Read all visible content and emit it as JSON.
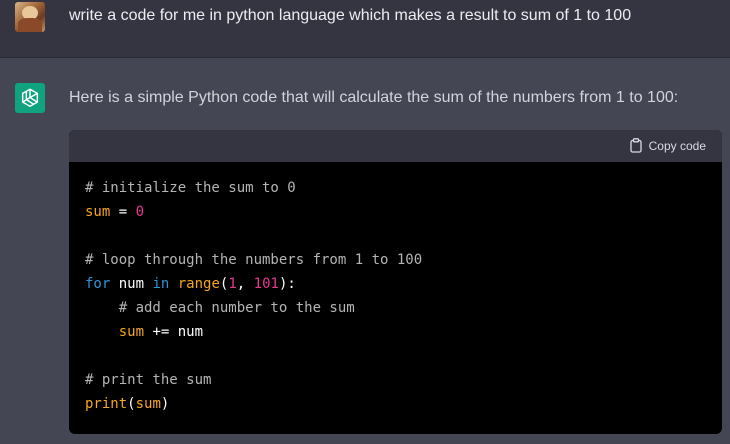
{
  "user_message": {
    "avatar": "user-avatar",
    "text": "write a code for me in python language which makes a result to sum of 1 to 100"
  },
  "assistant_message": {
    "avatar": "openai-logo-icon",
    "text": "Here is a simple Python code that will calculate the sum of the numbers from 1 to 100:",
    "code_block": {
      "copy_label": "Copy code",
      "lines": [
        [
          {
            "t": "# initialize the sum to 0",
            "c": "comment"
          }
        ],
        [
          {
            "t": "sum",
            "c": "var"
          },
          {
            "t": " = ",
            "c": "op"
          },
          {
            "t": "0",
            "c": "num"
          }
        ],
        [],
        [
          {
            "t": "# loop through the numbers from 1 to 100",
            "c": "comment"
          }
        ],
        [
          {
            "t": "for",
            "c": "kw"
          },
          {
            "t": " num ",
            "c": "op"
          },
          {
            "t": "in",
            "c": "kw"
          },
          {
            "t": " ",
            "c": "op"
          },
          {
            "t": "range",
            "c": "fn"
          },
          {
            "t": "(",
            "c": "op"
          },
          {
            "t": "1",
            "c": "num"
          },
          {
            "t": ", ",
            "c": "op"
          },
          {
            "t": "101",
            "c": "num"
          },
          {
            "t": "):",
            "c": "op"
          }
        ],
        [
          {
            "t": "    # add each number to the sum",
            "c": "comment"
          }
        ],
        [
          {
            "t": "    ",
            "c": "op"
          },
          {
            "t": "sum",
            "c": "var"
          },
          {
            "t": " += num",
            "c": "op"
          }
        ],
        [],
        [
          {
            "t": "# print the sum",
            "c": "comment"
          }
        ],
        [
          {
            "t": "print",
            "c": "fn"
          },
          {
            "t": "(",
            "c": "op"
          },
          {
            "t": "sum",
            "c": "var"
          },
          {
            "t": ")",
            "c": "op"
          }
        ]
      ]
    }
  },
  "colors": {
    "user_bg": "#343541",
    "assistant_bg": "#444654",
    "accent_green": "#10a37f",
    "code_bg": "#000000",
    "code_header_bg": "#343541"
  }
}
